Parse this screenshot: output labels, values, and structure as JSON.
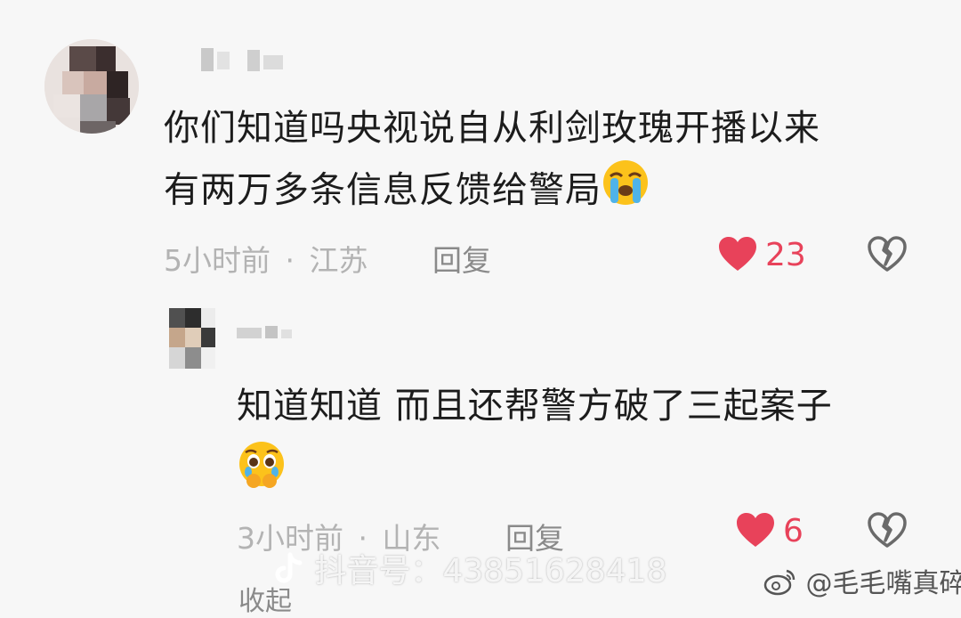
{
  "comments": [
    {
      "text_line1": "你们知道吗央视说自从利剑玫瑰开播以来",
      "text_line2": "有两万多条信息反馈给警局",
      "emoji": "loudly-crying-face",
      "time": "5小时前",
      "separator": "·",
      "location": "江苏",
      "reply_label": "回复",
      "likes": "23",
      "dislike_icon": "broken-heart-icon"
    },
    {
      "text_line1": "知道知道 而且还帮警方破了三起案子",
      "emoji": "pleading-crying-face",
      "time": "3小时前",
      "separator": "·",
      "location": "山东",
      "reply_label": "回复",
      "likes": "6",
      "dislike_icon": "broken-heart-icon"
    }
  ],
  "collapse_label": "收起",
  "watermarks": {
    "douyin": "抖音号：43851628418",
    "weibo": "@毛毛嘴真碎"
  },
  "colors": {
    "like_red": "#e8425a",
    "meta_gray": "#b3b3b3",
    "background": "#f7f7f7"
  }
}
